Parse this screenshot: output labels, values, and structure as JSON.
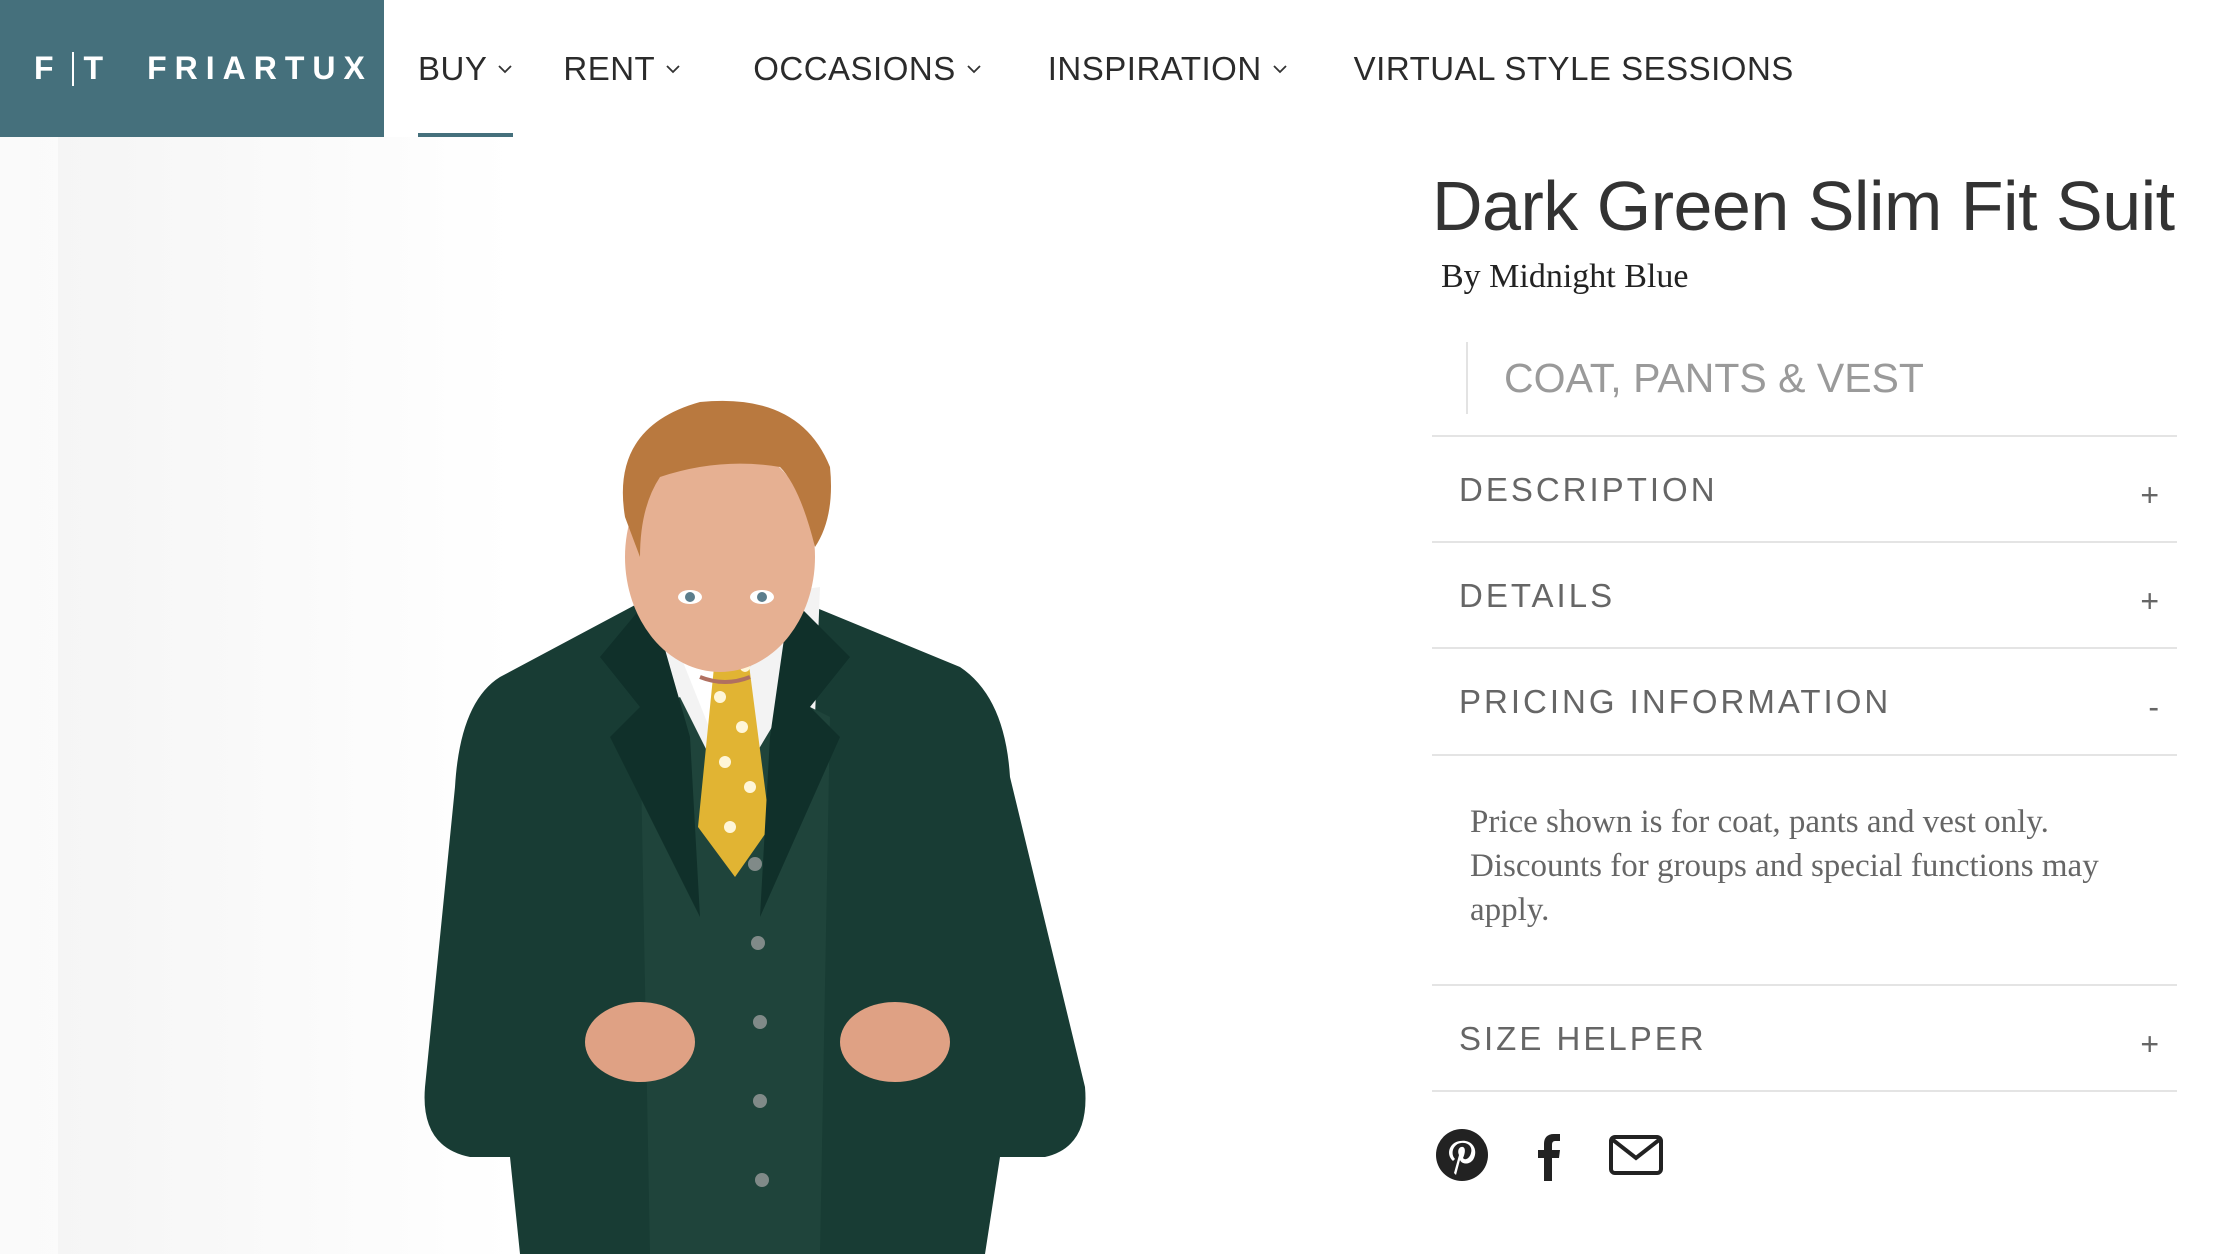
{
  "header": {
    "logo_mark_left": "F",
    "logo_mark_right": "T",
    "logo_name": "FRIARTUX",
    "nav": [
      {
        "label": "BUY",
        "has_dropdown": true,
        "active": true
      },
      {
        "label": "RENT",
        "has_dropdown": true
      },
      {
        "label": "OCCASIONS",
        "has_dropdown": true
      },
      {
        "label": "INSPIRATION",
        "has_dropdown": true
      },
      {
        "label": "VIRTUAL STYLE SESSIONS",
        "has_dropdown": false
      }
    ],
    "accent_color": "#45707c"
  },
  "product": {
    "title": "Dark Green Slim Fit Suit",
    "brand": "By Midnight Blue",
    "variant": "COAT, PANTS & VEST",
    "accordion": [
      {
        "label": "DESCRIPTION",
        "toggle": "+"
      },
      {
        "label": "DETAILS",
        "toggle": "+"
      },
      {
        "label": "PRICING INFORMATION",
        "toggle": "-",
        "content": "Price shown is for coat, pants and vest only. Discounts for groups and special functions may apply."
      },
      {
        "label": "SIZE HELPER",
        "toggle": "+"
      }
    ]
  },
  "share": {
    "icons": [
      "pinterest-icon",
      "facebook-icon",
      "email-icon"
    ]
  }
}
